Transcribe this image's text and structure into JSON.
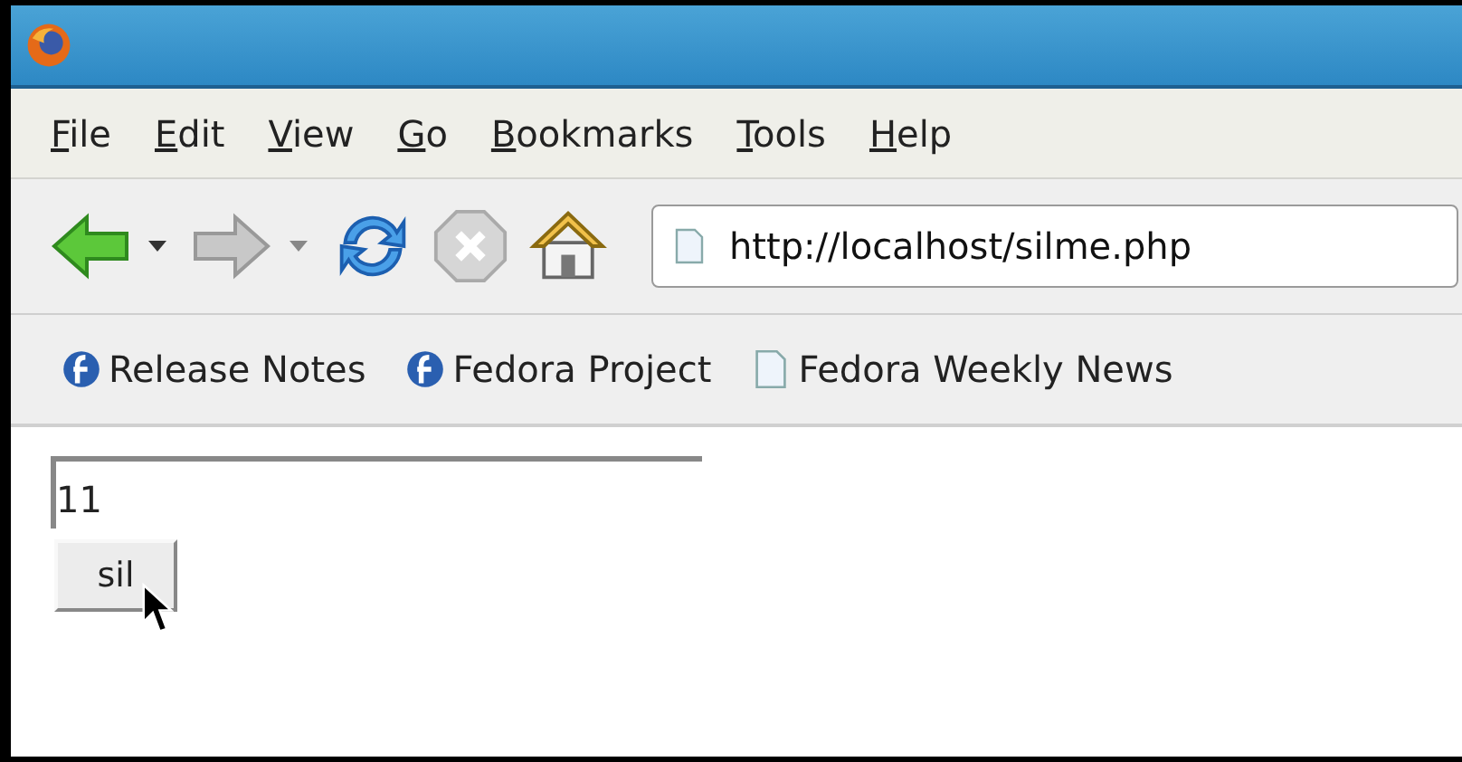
{
  "menu": [
    {
      "label": "File"
    },
    {
      "label": "Edit"
    },
    {
      "label": "View"
    },
    {
      "label": "Go"
    },
    {
      "label": "Bookmarks"
    },
    {
      "label": "Tools"
    },
    {
      "label": "Help"
    }
  ],
  "address_bar": {
    "value": "http://localhost/silme.php"
  },
  "bookmarks": [
    {
      "label": "Release Notes",
      "kind": "fedora"
    },
    {
      "label": "Fedora Project",
      "kind": "fedora"
    },
    {
      "label": "Fedora Weekly News",
      "kind": "page"
    }
  ],
  "page": {
    "field_value": "11",
    "button_label": "sil"
  }
}
